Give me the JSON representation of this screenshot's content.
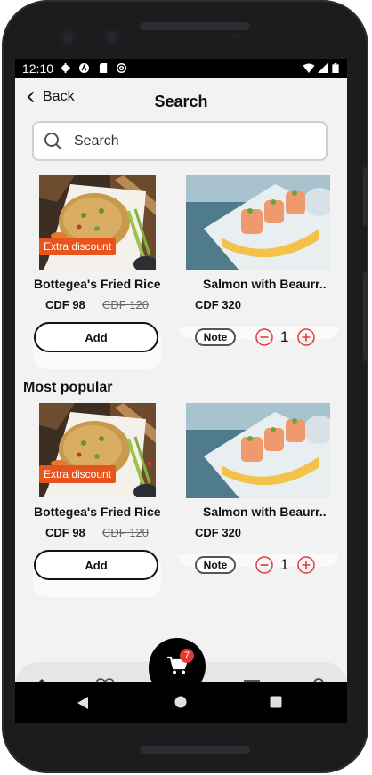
{
  "status_bar": {
    "time": "12:10",
    "left_icons": [
      "settings-icon",
      "a-badge-icon",
      "sd-card-icon",
      "at-sign-icon"
    ],
    "right_icons": [
      "wifi-icon",
      "signal-icon",
      "battery-icon"
    ]
  },
  "header": {
    "back_label": "Back",
    "title": "Search"
  },
  "search": {
    "placeholder": "Search"
  },
  "products": [
    {
      "name": "Bottegea's Fried Rice",
      "price": "CDF 98",
      "old_price": "CDF 120",
      "badge": "Extra discount",
      "action": "Add"
    },
    {
      "name": "Salmon with Beaurr..",
      "price": "CDF 320",
      "note_label": "Note",
      "quantity": "1"
    }
  ],
  "popular": {
    "title": "Most popular",
    "items": [
      {
        "name": "Bottegea's Fried Rice",
        "price": "CDF 98",
        "old_price": "CDF 120",
        "badge": "Extra discount",
        "action": "Add"
      },
      {
        "name": "Salmon with Beaurr..",
        "price": "CDF 320",
        "note_label": "Note",
        "quantity": "1"
      }
    ]
  },
  "bottom_nav": {
    "items": [
      "home-icon",
      "heart-icon",
      "cart-icon",
      "chat-icon",
      "profile-icon"
    ],
    "cart_count": "7"
  },
  "colors": {
    "accent": "#e8541c",
    "stepper_red": "#e23a3a",
    "background": "#f2f2f2"
  }
}
